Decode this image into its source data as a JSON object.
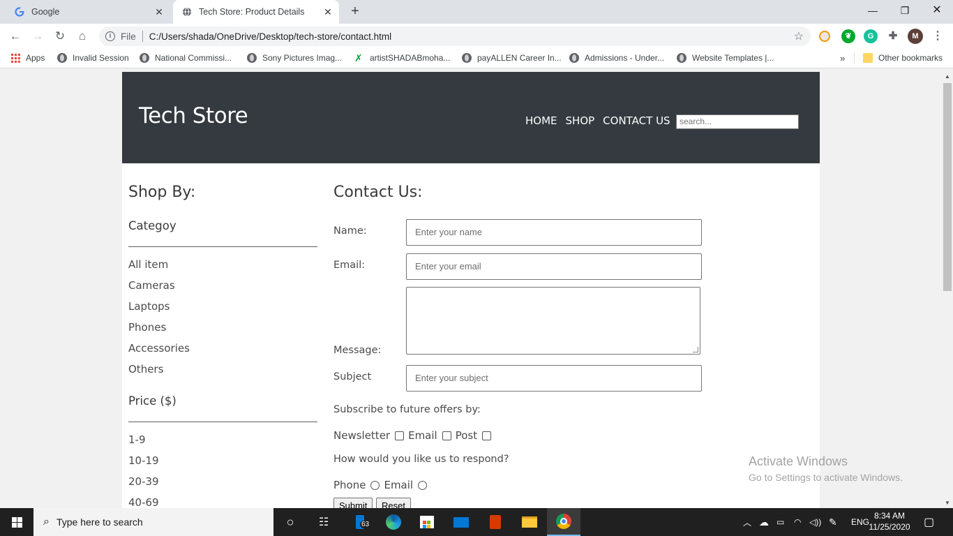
{
  "browser": {
    "tabs": [
      {
        "title": "Google",
        "active": false
      },
      {
        "title": "Tech Store: Product Details",
        "active": true
      }
    ],
    "address": {
      "protocol": "File",
      "url": "C:/Users/shada/OneDrive/Desktop/tech-store/contact.html"
    },
    "profile_initial": "M",
    "bookmarks": [
      "Apps",
      "Invalid Session",
      "National Commissi...",
      "Sony Pictures Imag...",
      "artistSHADABmoha...",
      "payALLEN Career In...",
      "Admissions - Under...",
      "Website Templates |..."
    ],
    "bookmarks_overflow": "»",
    "other_bookmarks": "Other bookmarks"
  },
  "site": {
    "logo": "Tech Store",
    "nav": [
      "HOME",
      "SHOP",
      "CONTACT US"
    ],
    "search_placeholder": "search..."
  },
  "sidebar": {
    "title": "Shop By:",
    "category_heading": "Categoy",
    "categories": [
      "All item",
      "Cameras",
      "Laptops",
      "Phones",
      "Accessories",
      "Others"
    ],
    "price_heading": "Price ($)",
    "prices": [
      "1-9",
      "10-19",
      "20-39",
      "40-69"
    ]
  },
  "contact": {
    "title": "Contact Us:",
    "name_label": "Name:",
    "name_placeholder": "Enter your name",
    "email_label": "Email:",
    "email_placeholder": "Enter your email",
    "message_label": "Message:",
    "subject_label": "Subject",
    "subject_placeholder": "Enter your subject",
    "subscribe_prompt": "Subscribe to future offers by:",
    "subscribe_options": [
      "Newsletter",
      "Email",
      "Post"
    ],
    "respond_prompt": "How would you like us to respond?",
    "respond_options": [
      "Phone",
      "Email"
    ],
    "submit_label": "Submit",
    "reset_label": "Reset"
  },
  "watermark": {
    "line1": "Activate Windows",
    "line2": "Go to Settings to activate Windows."
  },
  "taskbar": {
    "search_placeholder": "Type here to search",
    "badge_count": "63",
    "language": "ENG",
    "time": "8:34 AM",
    "date": "11/25/2020"
  },
  "colors": {
    "site_header": "#343a40",
    "taskbar": "#202020",
    "tab_strip": "#dee1e6"
  }
}
